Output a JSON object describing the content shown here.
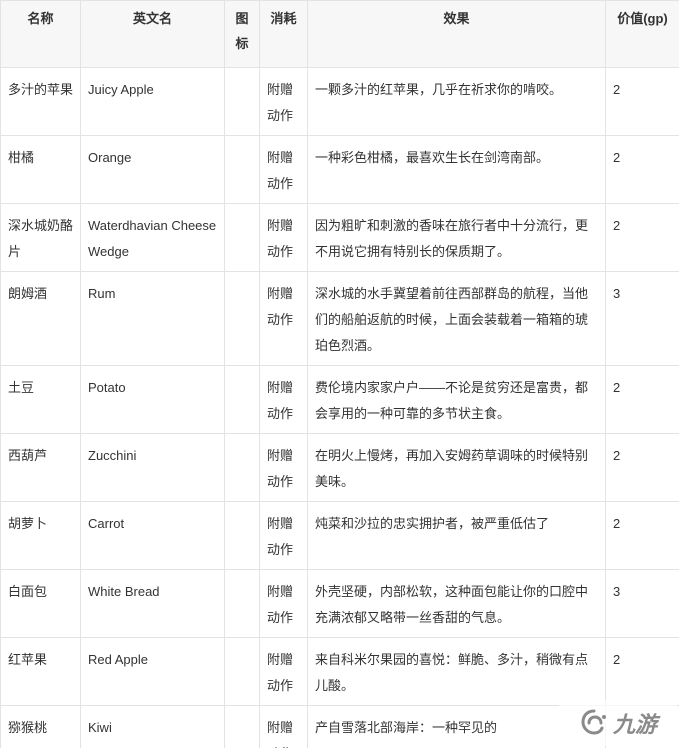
{
  "table": {
    "headers": [
      "名称",
      "英文名",
      "图标",
      "消耗",
      "效果",
      "价值(gp)"
    ],
    "rows": [
      {
        "name": "多汁的苹果",
        "english": "Juicy Apple",
        "icon": "",
        "cost": "附赠动作",
        "effect": "一颗多汁的红苹果，几乎在祈求你的啃咬。",
        "value": "2"
      },
      {
        "name": "柑橘",
        "english": "Orange",
        "icon": "",
        "cost": "附赠动作",
        "effect": "一种彩色柑橘，最喜欢生长在剑湾南部。",
        "value": "2"
      },
      {
        "name": "深水城奶酪片",
        "english": "Waterdhavian Cheese Wedge",
        "icon": "",
        "cost": "附赠动作",
        "effect": "因为粗旷和刺激的香味在旅行者中十分流行，更不用说它拥有特别长的保质期了。",
        "value": "2"
      },
      {
        "name": "朗姆酒",
        "english": "Rum",
        "icon": "",
        "cost": "附赠动作",
        "effect": "深水城的水手冀望着前往西部群岛的航程，当他们的船舶返航的时候，上面会装载着一箱箱的琥珀色烈酒。",
        "value": "3"
      },
      {
        "name": "土豆",
        "english": "Potato",
        "icon": "",
        "cost": "附赠动作",
        "effect": "费伦境内家家户户——不论是贫穷还是富贵，都会享用的一种可靠的多节状主食。",
        "value": "2"
      },
      {
        "name": "西葫芦",
        "english": "Zucchini",
        "icon": "",
        "cost": "附赠动作",
        "effect": "在明火上慢烤，再加入安姆药草调味的时候特别美味。",
        "value": "2"
      },
      {
        "name": "胡萝卜",
        "english": "Carrot",
        "icon": "",
        "cost": "附赠动作",
        "effect": "炖菜和沙拉的忠实拥护者，被严重低估了",
        "value": "2"
      },
      {
        "name": "白面包",
        "english": "White Bread",
        "icon": "",
        "cost": "附赠动作",
        "effect": "外壳坚硬，内部松软，这种面包能让你的口腔中充满浓郁又略带一丝香甜的气息。",
        "value": "3"
      },
      {
        "name": "红苹果",
        "english": "Red Apple",
        "icon": "",
        "cost": "附赠动作",
        "effect": "来自科米尔果园的喜悦：鲜脆、多汁，稍微有点儿酸。",
        "value": "2"
      },
      {
        "name": "猕猴桃",
        "english": "Kiwi",
        "icon": "",
        "cost": "附赠动作",
        "effect": "产自雪落北部海岸：一种罕见的",
        "value": ""
      }
    ]
  },
  "watermark": {
    "text": "九游",
    "icon": "swirl-logo-icon"
  }
}
